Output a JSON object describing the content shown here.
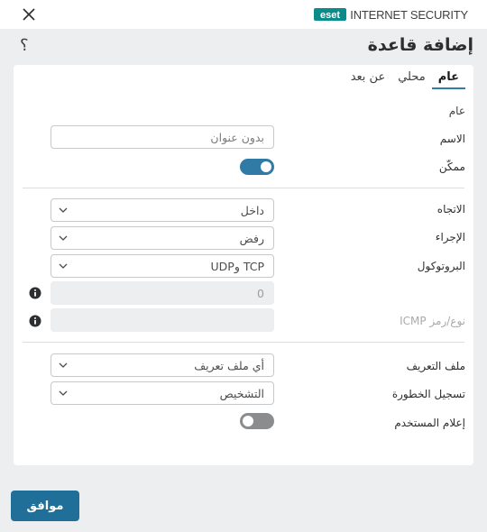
{
  "window": {
    "brand_logo_text": "eset",
    "brand_product": "INTERNET SECURITY"
  },
  "header": {
    "title": "إضافة قاعدة",
    "help": "؟"
  },
  "tabs": [
    {
      "label": "عام",
      "active": true
    },
    {
      "label": "محلي",
      "active": false
    },
    {
      "label": "عن بعد",
      "active": false
    }
  ],
  "general": {
    "section_label": "عام",
    "name_label": "الاسم",
    "name_placeholder": "بدون عنوان",
    "enabled_label": "ممكّن",
    "enabled": true
  },
  "traffic": {
    "direction_label": "الاتجاه",
    "direction_value": "داخل",
    "action_label": "الإجراء",
    "action_value": "رفض",
    "protocol_label": "البروتوكول",
    "protocol_value": "TCP وUDP",
    "port_value": "0",
    "icmp_label": "نوع/رمز ICMP",
    "icmp_value": ""
  },
  "profile": {
    "profile_label": "ملف التعريف",
    "profile_value": "أي ملف تعريف",
    "log_label": "تسجيل الخطورة",
    "log_value": "التشخيص",
    "notify_label": "إعلام المستخدم",
    "notify": false
  },
  "footer": {
    "ok_label": "موافق"
  },
  "colors": {
    "accent": "#2f7ba5",
    "button": "#1f6f99",
    "background": "#eceef0"
  }
}
